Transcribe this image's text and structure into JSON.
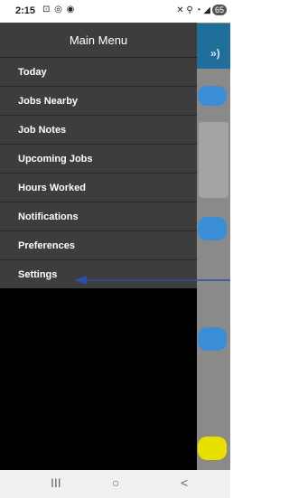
{
  "status_bar": {
    "time": "2:15",
    "left_icons": "⊡ ◎ ◉",
    "right_icons": "✕ ⚲ ◔ ◢",
    "battery": "65"
  },
  "drawer": {
    "title": "Main Menu",
    "items": [
      {
        "label": "Today"
      },
      {
        "label": "Jobs Nearby"
      },
      {
        "label": "Job Notes"
      },
      {
        "label": "Upcoming Jobs"
      },
      {
        "label": "Hours Worked"
      },
      {
        "label": "Notifications"
      },
      {
        "label": "Preferences"
      },
      {
        "label": "Settings"
      }
    ]
  },
  "nav_bar": {
    "recents": "III",
    "home": "○",
    "back": "<"
  },
  "colors": {
    "drawer_bg": "#3d3d3d",
    "overlay": "#8a8a8a",
    "header_accent": "#1f6f9a",
    "pill_blue": "#3b8ed6",
    "pill_yellow": "#e9e000",
    "annotation_arrow": "#2e4fa3"
  }
}
